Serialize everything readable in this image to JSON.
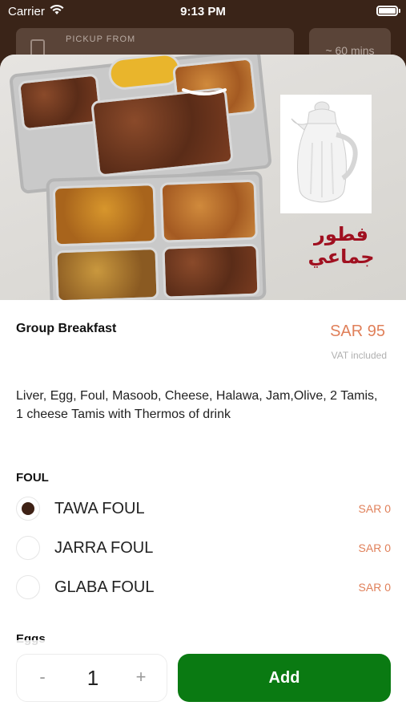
{
  "status_bar": {
    "carrier": "Carrier",
    "time": "9:13 PM"
  },
  "header": {
    "pickup_label": "PICKUP FROM",
    "eta": "~ 60 mins"
  },
  "hero": {
    "arabic_text": "فطور جماعي"
  },
  "item": {
    "title": "Group Breakfast",
    "price": "SAR 95",
    "vat_note": "VAT included",
    "description": "Liver, Egg, Foul, Masoob, Cheese, Halawa, Jam,Olive, 2 Tamis, 1 cheese Tamis with Thermos of drink"
  },
  "sections": [
    {
      "title": "FOUL",
      "options": [
        {
          "label": "TAWA FOUL",
          "price": "SAR 0",
          "selected": true
        },
        {
          "label": "JARRA FOUL",
          "price": "SAR 0",
          "selected": false
        },
        {
          "label": "GLABA FOUL",
          "price": "SAR 0",
          "selected": false
        }
      ]
    },
    {
      "title": "Eggs",
      "options": []
    }
  ],
  "footer": {
    "minus": "-",
    "quantity": "1",
    "plus": "+",
    "add_label": "Add"
  },
  "colors": {
    "header_bg": "#3a2418",
    "price": "#e0805a",
    "add_button": "#0a7a12",
    "radio_selected": "#3e2115"
  }
}
